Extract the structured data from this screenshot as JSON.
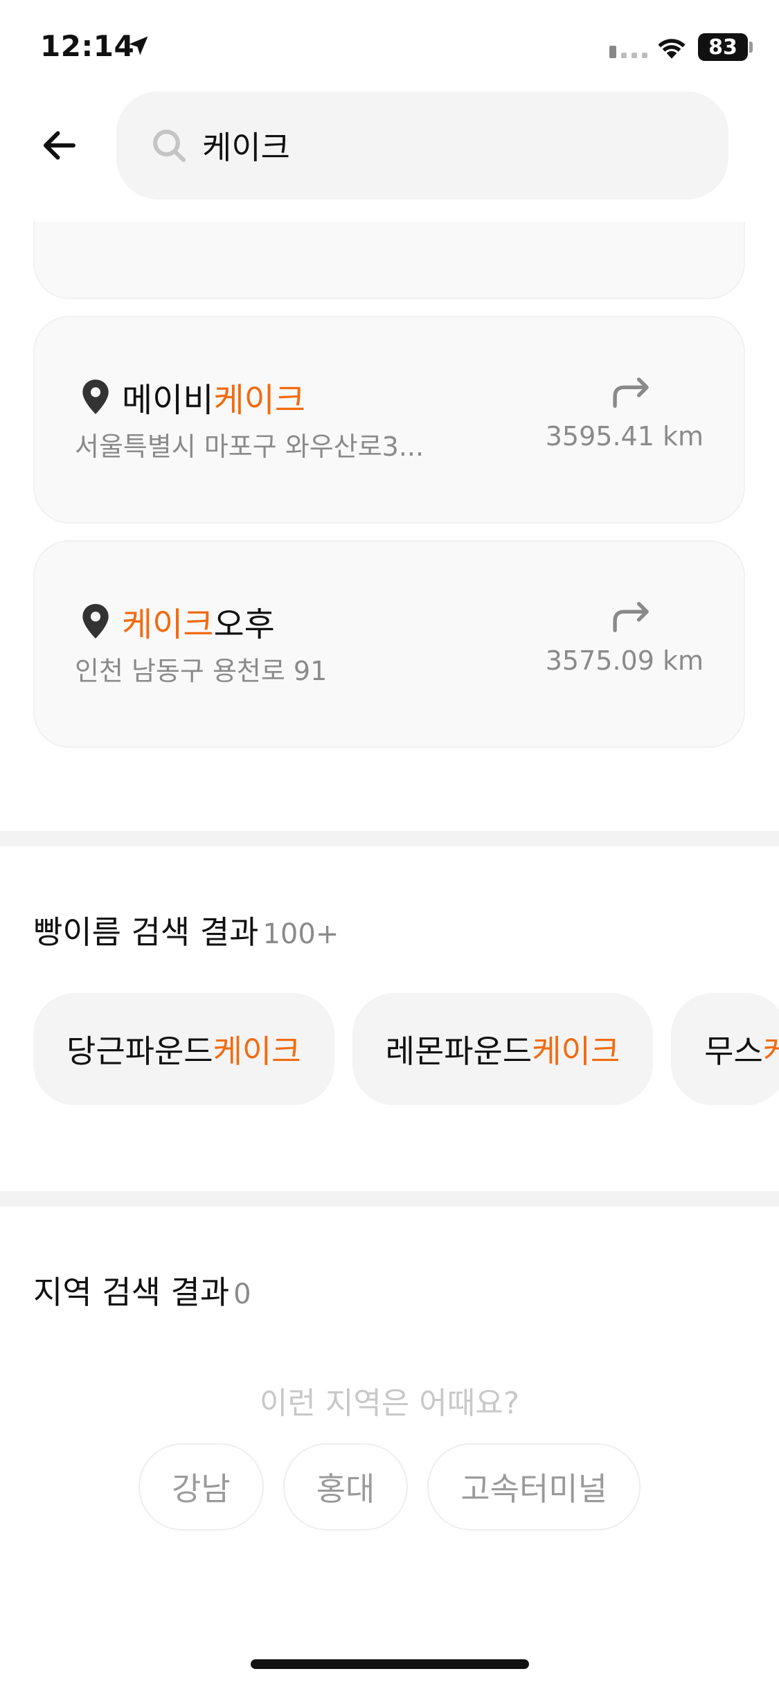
{
  "status_bar": {
    "time": "12:14",
    "battery": "83",
    "icons": [
      "location-arrow-icon",
      "signal-icon",
      "wifi-icon",
      "battery-icon"
    ]
  },
  "header": {
    "back_icon": "arrow-left-icon",
    "search_icon": "search-icon",
    "search_value": "케이크"
  },
  "results": [
    {
      "name_before": "메이비",
      "name_highlight": "케이크",
      "name_after": "",
      "address": "서울특별시 마포구 와우산로3...",
      "distance": "3595.41 km"
    },
    {
      "name_before": "",
      "name_highlight": "케이크",
      "name_after": "오후",
      "address": "인천 남동구 용천로 91",
      "distance": "3575.09 km"
    }
  ],
  "bread_section": {
    "title": "빵이름 검색 결과",
    "count": "100+",
    "chips": [
      {
        "before": "당근파운드",
        "highlight": "케이크"
      },
      {
        "before": "레몬파운드",
        "highlight": "케이크"
      },
      {
        "before": "무스",
        "highlight": "케이크"
      }
    ]
  },
  "area_section": {
    "title": "지역 검색 결과",
    "count": "0",
    "suggestion_prompt": "이런 지역은 어때요?",
    "suggestions": [
      "강남",
      "홍대",
      "고속터미널"
    ]
  },
  "colors": {
    "highlight": "#f26b0f",
    "card_bg": "#f9f9f9",
    "chip_bg": "#f4f4f4",
    "muted_text": "#8a8a8a"
  }
}
